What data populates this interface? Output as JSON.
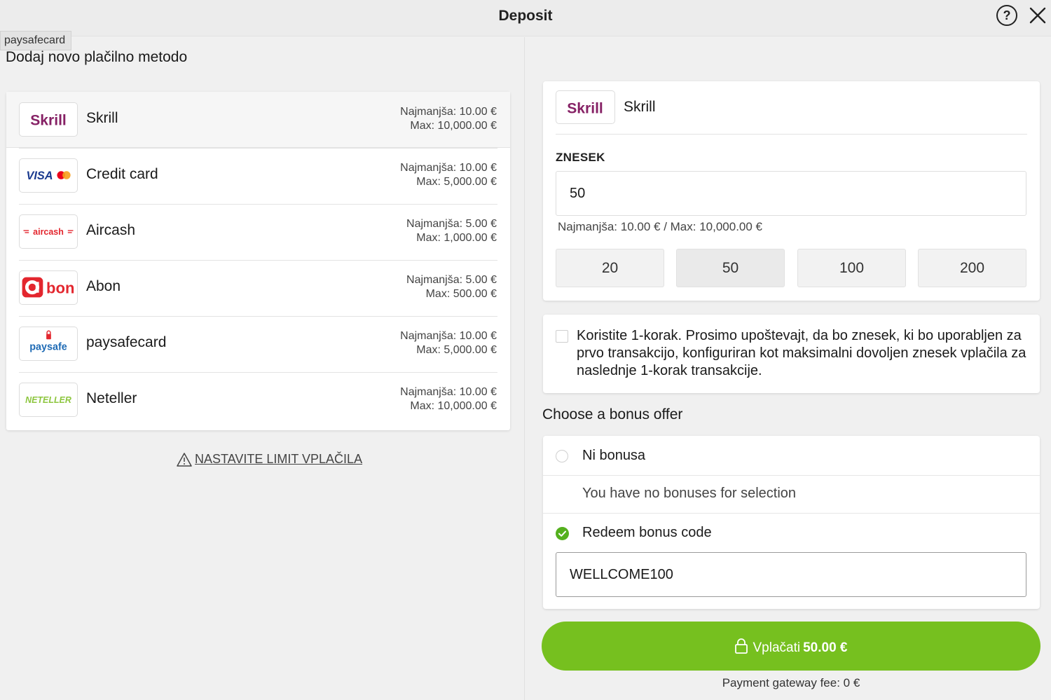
{
  "header": {
    "title": "Deposit",
    "help_symbol": "?"
  },
  "tooltip": "paysafecard",
  "left": {
    "title": "Dodaj novo plačilno metodo",
    "methods": [
      {
        "logo": "skrill-logo",
        "logo_text": "Skrill",
        "name": "Skrill",
        "min": "Najmanjša: 10.00 €",
        "max": "Max: 10,000.00 €"
      },
      {
        "logo": "visa-mastercard-logo",
        "logo_text": "VISA",
        "name": "Credit card",
        "min": "Najmanjša: 10.00 €",
        "max": "Max: 5,000.00 €"
      },
      {
        "logo": "aircash-logo",
        "logo_text": "aircash",
        "name": "Aircash",
        "min": "Najmanjša: 5.00 €",
        "max": "Max: 1,000.00 €"
      },
      {
        "logo": "abon-logo",
        "logo_text": "bon",
        "name": "Abon",
        "min": "Najmanjša: 5.00 €",
        "max": "Max: 500.00 €"
      },
      {
        "logo": "paysafe-logo",
        "logo_text": "paysafe",
        "name": "paysafecard",
        "min": "Najmanjša: 10.00 €",
        "max": "Max: 5,000.00 €"
      },
      {
        "logo": "neteller-logo",
        "logo_text": "NETELLER",
        "name": "Neteller",
        "min": "Najmanjša: 10.00 €",
        "max": "Max: 10,000.00 €"
      }
    ],
    "limit_link": "NASTAVITE LIMIT VPLAČILA"
  },
  "right": {
    "selected_method": {
      "logo_text": "Skrill",
      "name": "Skrill"
    },
    "amount_label": "ZNESEK",
    "amount_value": "50",
    "amount_hint": "Najmanjša: 10.00 € / Max: 10,000.00 €",
    "quick_amounts": [
      "20",
      "50",
      "100",
      "200"
    ],
    "one_step_text": "Koristite 1-korak. Prosimo upoštevajt, da bo znesek, ki bo uporabljen za prvo transakcijo, konfiguriran kot maksimalni dovoljen znesek vplačila za naslednje 1-korak transakcije.",
    "bonus_title": "Choose a bonus offer",
    "bonus_none": "Ni bonusa",
    "bonus_empty": "You have no bonuses for selection",
    "bonus_redeem": "Redeem bonus code",
    "bonus_code": "WELLCOME100",
    "pay_label": "Vplačati",
    "pay_amount": "50.00 €",
    "fee": "Payment gateway fee: 0 €"
  },
  "colors": {
    "accent_green": "#76c01f",
    "check_green": "#54b01e",
    "skrill_purple": "#862165",
    "abon_red": "#e3262e",
    "neteller_green": "#8dc63f"
  }
}
